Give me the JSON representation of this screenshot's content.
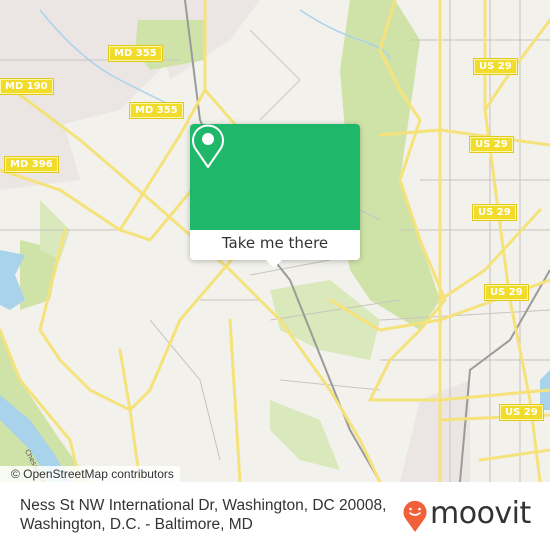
{
  "map": {
    "road_shields": [
      {
        "id": "md355-top",
        "label": "MD 355"
      },
      {
        "id": "md190",
        "label": "MD 190"
      },
      {
        "id": "md355-mid",
        "label": "MD 355"
      },
      {
        "id": "md396",
        "label": "MD 396"
      },
      {
        "id": "us29-a",
        "label": "US 29"
      },
      {
        "id": "us29-b",
        "label": "US 29"
      },
      {
        "id": "us29-c",
        "label": "US 29"
      },
      {
        "id": "us29-d",
        "label": "US 29"
      },
      {
        "id": "us29-e",
        "label": "US 29"
      }
    ],
    "street_label": "Chesapeake",
    "attribution": "© OpenStreetMap contributors",
    "colors": {
      "background": "#f2f1ec",
      "park": "#cfe3a8",
      "water": "#a9d3ea",
      "road": "#f5e27a",
      "urban": "#ebe6e4"
    }
  },
  "popup": {
    "icon": "map-pin-icon",
    "button_label": "Take me there",
    "color": "#1fb86a"
  },
  "footer": {
    "address_line1": "Ness St NW International Dr, Washington, DC 20008,",
    "address_line2": "Washington, D.C. - Baltimore, MD",
    "logo_text": "moovit",
    "logo_color": "#f2603a"
  }
}
